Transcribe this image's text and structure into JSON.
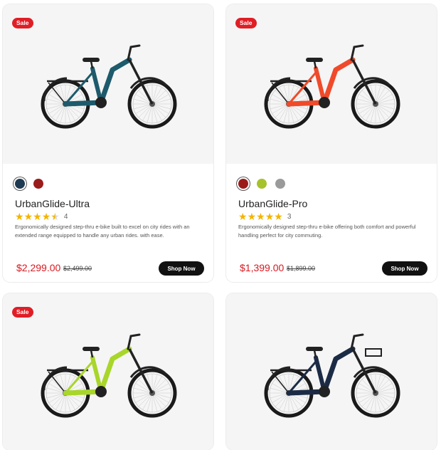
{
  "products": [
    {
      "badge": "Sale",
      "frame_color": "#1d5a6c",
      "swatches": [
        {
          "color": "#1e3a52",
          "selected": true
        },
        {
          "color": "#9b1b1b",
          "selected": false
        }
      ],
      "name": "UrbanGlide-Ultra",
      "rating": 4.5,
      "rating_count": "4",
      "description": "Ergonomically designed step-thru e-bike built to excel on city rides with an extended range equipped to handle any urban rides. with ease.",
      "price": "$2,299.00",
      "old_price": "$2,499.00",
      "cta": "Shop Now"
    },
    {
      "badge": "Sale",
      "frame_color": "#f04a2a",
      "swatches": [
        {
          "color": "#9b1b1b",
          "selected": true
        },
        {
          "color": "#a6c22a",
          "selected": false
        },
        {
          "color": "#9a9a9a",
          "selected": false
        }
      ],
      "name": "UrbanGlide-Pro",
      "rating": 5,
      "rating_count": "3",
      "description": "Ergonomically designed step-thru e-bike offering both comfort and powerful handling perfect for city commuting.",
      "price": "$1,399.00",
      "old_price": "$1,899.00",
      "cta": "Shop Now"
    },
    {
      "badge": "Sale",
      "frame_color": "#a8d62a"
    },
    {
      "badge": "",
      "frame_color": "#1c2b45"
    }
  ]
}
